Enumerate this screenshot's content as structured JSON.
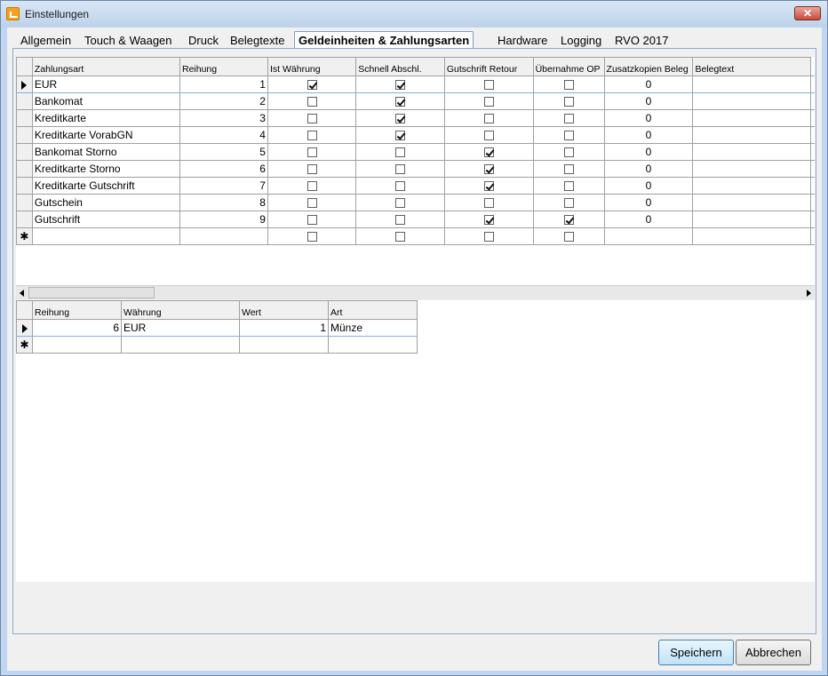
{
  "window": {
    "title": "Einstellungen",
    "close_symbol": "✕",
    "icon": "app-icon"
  },
  "tabs": [
    {
      "label": "Allgemein",
      "active": false
    },
    {
      "label": "Touch & Waagen",
      "active": false
    },
    {
      "label": "Druck",
      "active": false
    },
    {
      "label": "Belegtexte",
      "active": false
    },
    {
      "label": "Geldeinheiten & Zahlungsarten",
      "active": true
    },
    {
      "label": "Hardware",
      "active": false
    },
    {
      "label": "Logging",
      "active": false
    },
    {
      "label": "RVO 2017",
      "active": false
    }
  ],
  "payment_grid": {
    "columns": [
      "Zahlungsart",
      "Reihung",
      "Ist Währung",
      "Schnell Abschl.",
      "Gutschrift Retour",
      "Übernahme OP",
      "Zusatzkopien Beleg",
      "Belegtext"
    ],
    "rows": [
      {
        "zahlungsart": "EUR",
        "reihung": "1",
        "ist_waehrung": true,
        "schnell": true,
        "gutschrift": false,
        "uebernahme": false,
        "zusatzkopien": "0",
        "belegtext": "",
        "current": true
      },
      {
        "zahlungsart": "Bankomat",
        "reihung": "2",
        "ist_waehrung": false,
        "schnell": true,
        "gutschrift": false,
        "uebernahme": false,
        "zusatzkopien": "0",
        "belegtext": ""
      },
      {
        "zahlungsart": "Kreditkarte",
        "reihung": "3",
        "ist_waehrung": false,
        "schnell": true,
        "gutschrift": false,
        "uebernahme": false,
        "zusatzkopien": "0",
        "belegtext": ""
      },
      {
        "zahlungsart": "Kreditkarte VorabGN",
        "reihung": "4",
        "ist_waehrung": false,
        "schnell": true,
        "gutschrift": false,
        "uebernahme": false,
        "zusatzkopien": "0",
        "belegtext": ""
      },
      {
        "zahlungsart": "Bankomat Storno",
        "reihung": "5",
        "ist_waehrung": false,
        "schnell": false,
        "gutschrift": true,
        "uebernahme": false,
        "zusatzkopien": "0",
        "belegtext": ""
      },
      {
        "zahlungsart": "Kreditkarte Storno",
        "reihung": "6",
        "ist_waehrung": false,
        "schnell": false,
        "gutschrift": true,
        "uebernahme": false,
        "zusatzkopien": "0",
        "belegtext": ""
      },
      {
        "zahlungsart": "Kreditkarte Gutschrift",
        "reihung": "7",
        "ist_waehrung": false,
        "schnell": false,
        "gutschrift": true,
        "uebernahme": false,
        "zusatzkopien": "0",
        "belegtext": ""
      },
      {
        "zahlungsart": "Gutschein",
        "reihung": "8",
        "ist_waehrung": false,
        "schnell": false,
        "gutschrift": false,
        "uebernahme": false,
        "zusatzkopien": "0",
        "belegtext": ""
      },
      {
        "zahlungsart": "Gutschrift",
        "reihung": "9",
        "ist_waehrung": false,
        "schnell": false,
        "gutschrift": true,
        "uebernahme": true,
        "zusatzkopien": "0",
        "belegtext": ""
      }
    ],
    "new_row": {
      "marker": "✱",
      "ist_waehrung": false,
      "schnell": false,
      "gutschrift": false,
      "uebernahme": false
    }
  },
  "currency_grid": {
    "columns": [
      "Reihung",
      "Währung",
      "Wert",
      "Art"
    ],
    "rows": [
      {
        "reihung": "6",
        "waehrung": "EUR",
        "wert": "1",
        "art": "Münze",
        "current": true
      }
    ],
    "new_row": {
      "marker": "✱"
    }
  },
  "buttons": {
    "save": "Speichern",
    "cancel": "Abbrechen"
  }
}
